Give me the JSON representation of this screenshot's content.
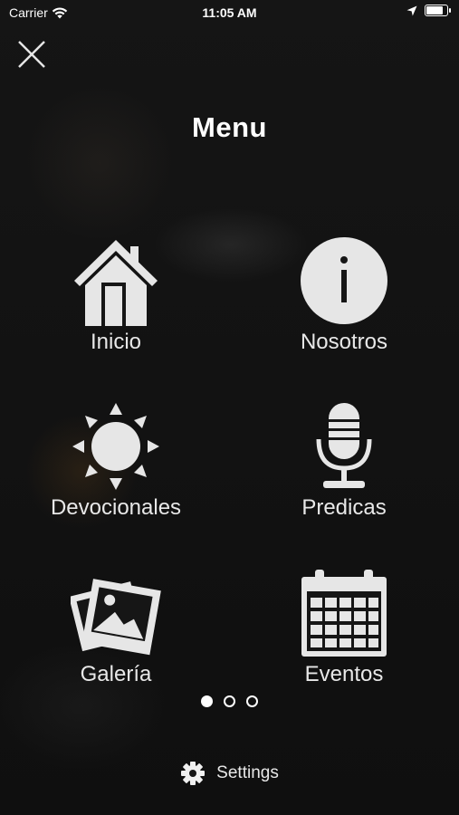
{
  "status_bar": {
    "carrier": "Carrier",
    "time": "11:05 AM"
  },
  "header": {
    "title": "Menu"
  },
  "menu": {
    "items": [
      {
        "label": "Inicio",
        "icon": "house-icon"
      },
      {
        "label": "Nosotros",
        "icon": "info-icon"
      },
      {
        "label": "Devocionales",
        "icon": "sun-icon"
      },
      {
        "label": "Predicas",
        "icon": "microphone-icon"
      },
      {
        "label": "Galería",
        "icon": "photo-icon"
      },
      {
        "label": "Eventos",
        "icon": "calendar-icon"
      }
    ]
  },
  "pager": {
    "pages": 3,
    "current": 1
  },
  "footer": {
    "settings_label": "Settings",
    "icon": "gear-icon"
  },
  "colors": {
    "icon": "#e6e6e6",
    "background": "#121212"
  }
}
